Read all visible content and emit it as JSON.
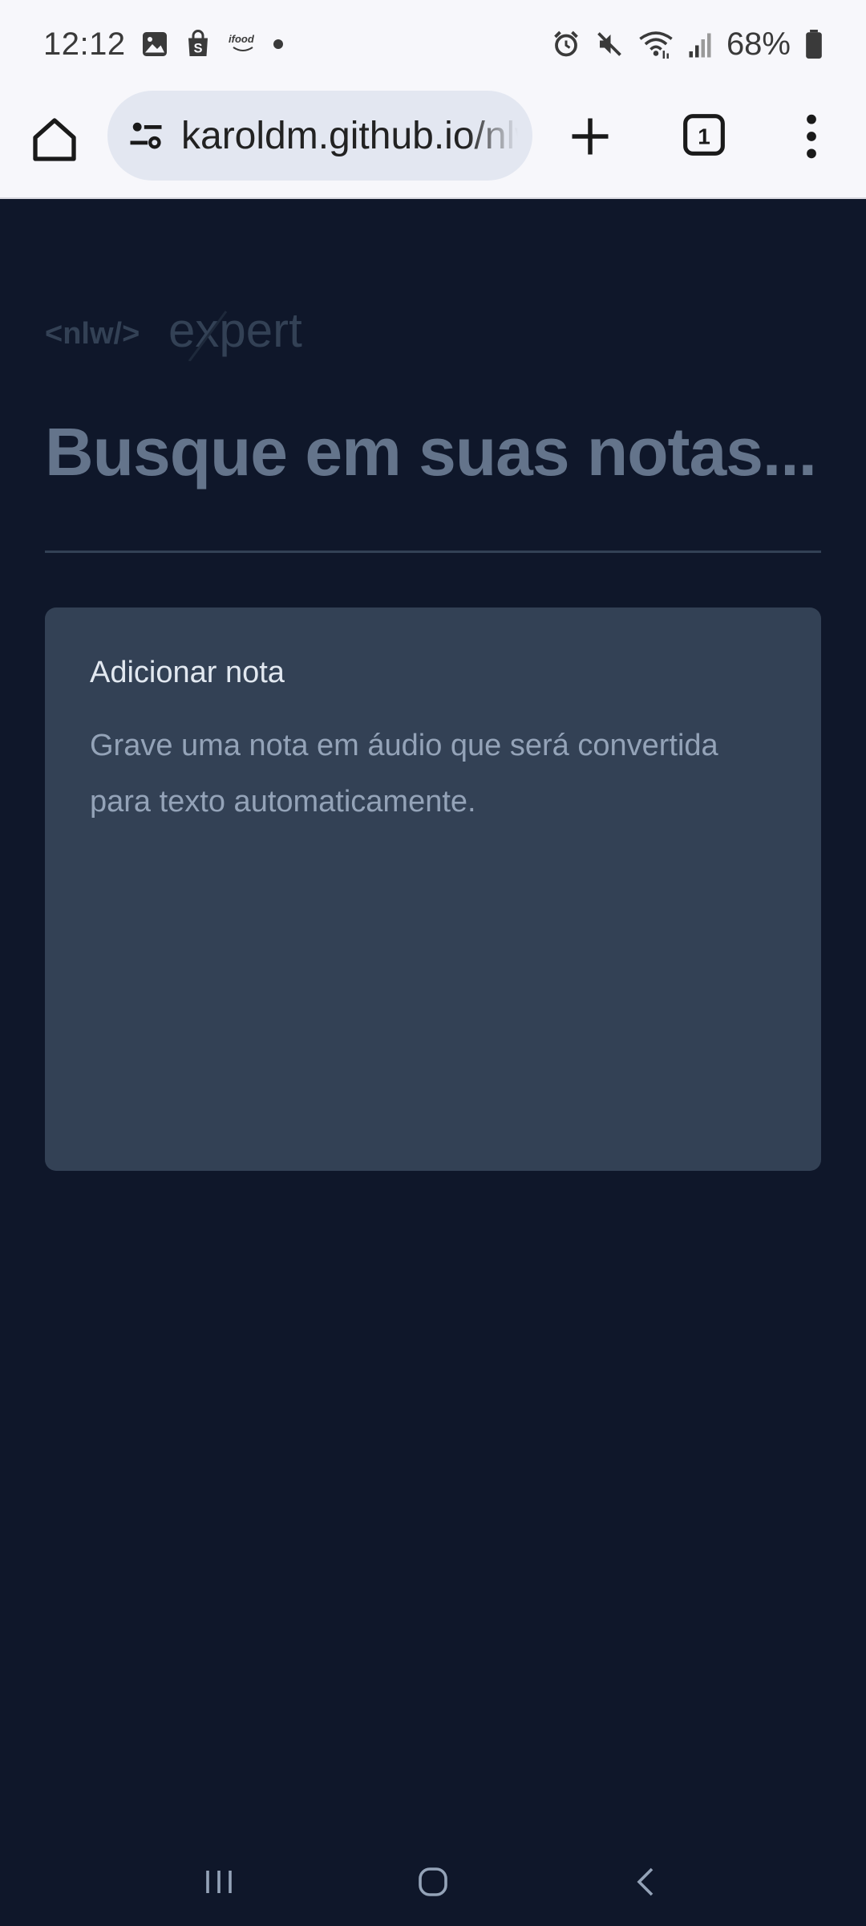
{
  "status_bar": {
    "time": "12:12",
    "battery": "68%",
    "icons": [
      "image-icon",
      "shopping-bag-icon",
      "ifood-icon",
      "dot-icon",
      "alarm-icon",
      "mute-icon",
      "wifi-icon",
      "signal-icon",
      "battery-icon"
    ],
    "ifood_text": "ifood"
  },
  "browser": {
    "url": "karoldm.github.io/nlw-expert",
    "tab_count": "1"
  },
  "page": {
    "logo_text_left": "<nlw/>",
    "logo_text_right": "expert",
    "title": "Busque em suas notas...",
    "card": {
      "title": "Adicionar nota",
      "description": "Grave uma nota em áudio que será convertida para texto automaticamente."
    }
  },
  "colors": {
    "background": "#0f172a",
    "card": "#334155",
    "title": "#64748b",
    "muted": "#94a3b8"
  }
}
